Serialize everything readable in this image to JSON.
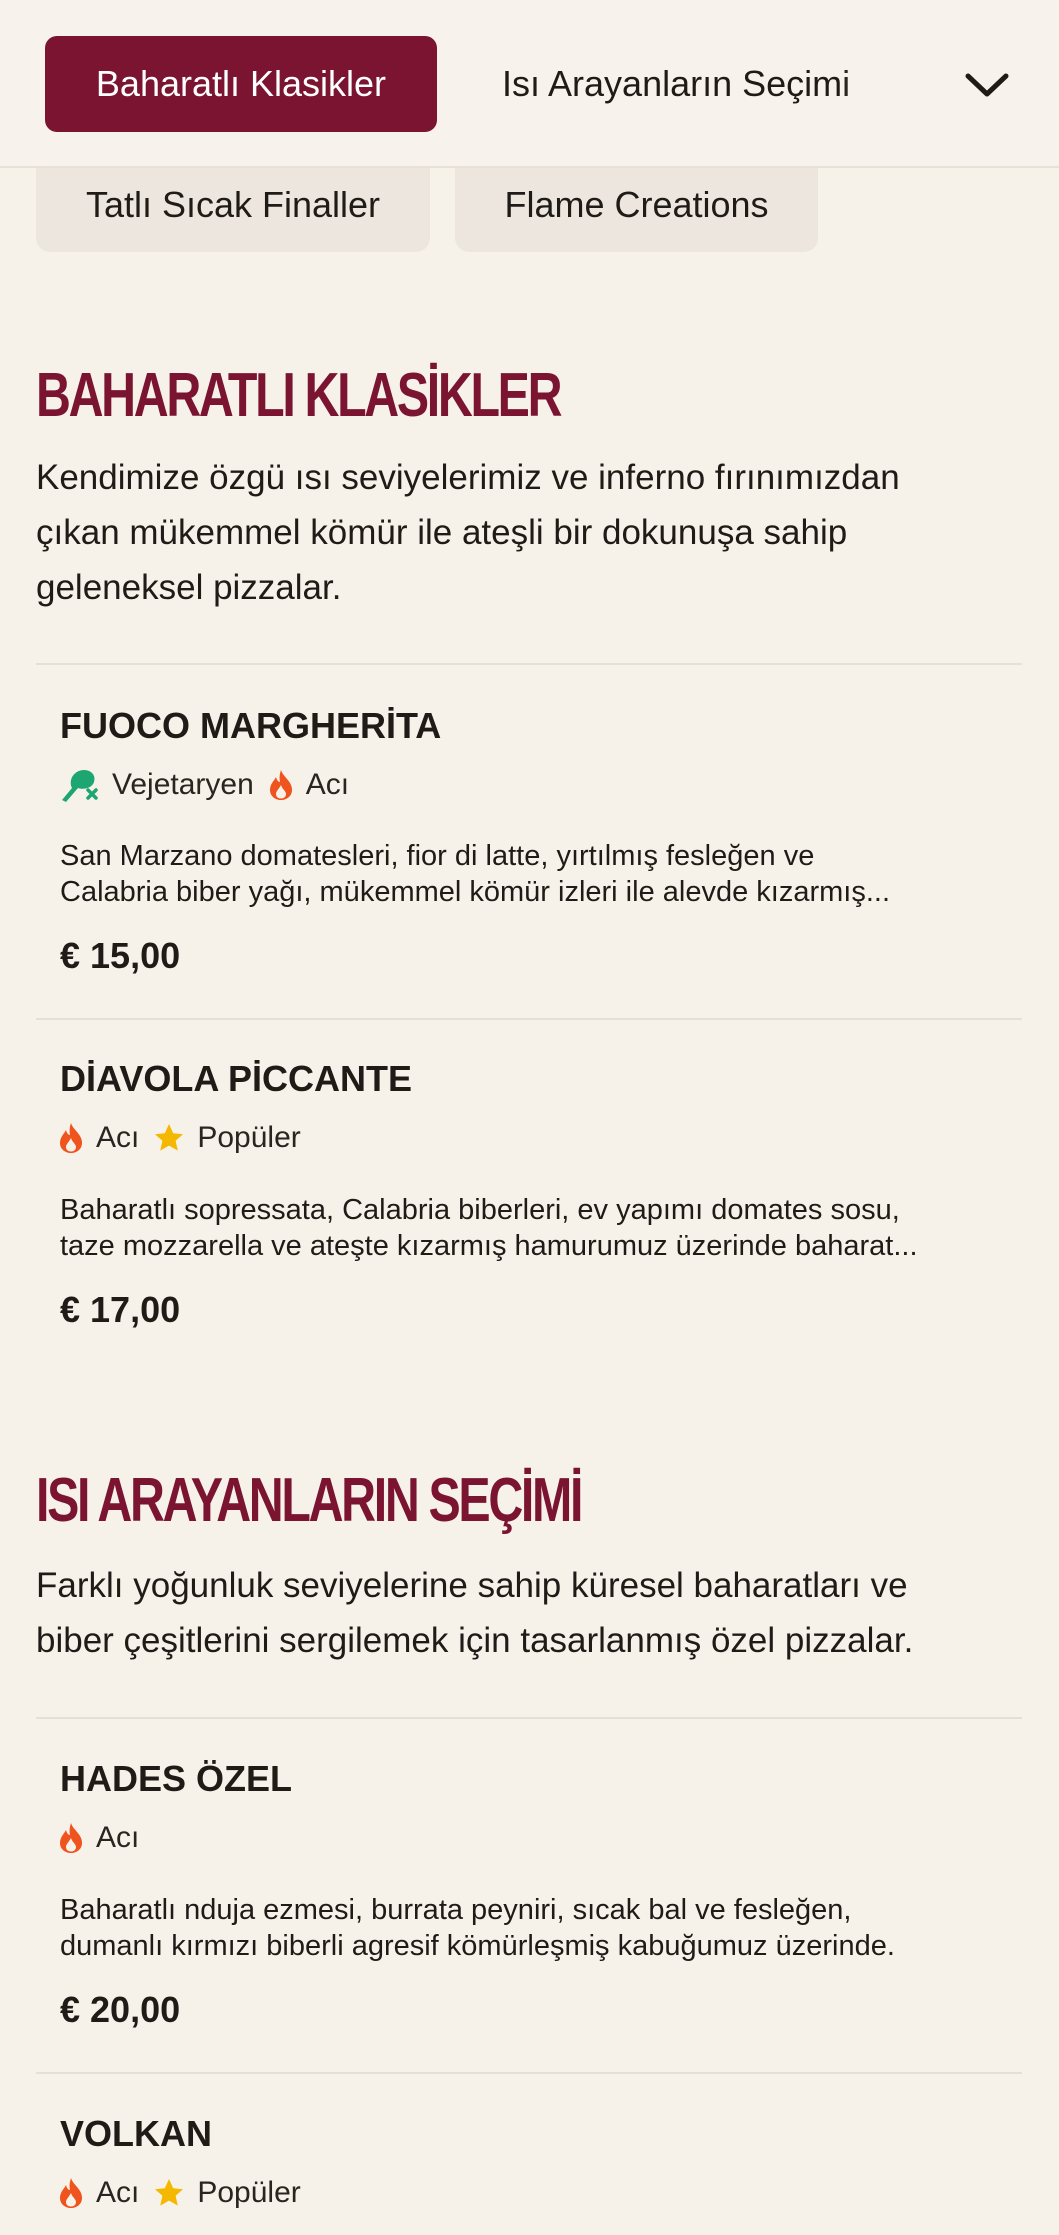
{
  "nav": {
    "active_label": "Baharatlı Klasikler",
    "second_label": "Isı Arayanların Seçimi",
    "row2": [
      "Tatlı Sıcak Finaller",
      "Flame Creations"
    ]
  },
  "sections": [
    {
      "title": "BAHARATLI KLASİKLER",
      "desc_lines": [
        "Kendimize özgü ısı seviyelerimiz ve inferno fırınımızdan",
        "çıkan mükemmel kömür ile ateşli bir dokunuşa sahip",
        "geleneksel pizzalar."
      ],
      "items": [
        {
          "name": "FUOCO MARGHERİTA",
          "tags": [
            {
              "icon": "vegetarian-icon",
              "label": "Vejetaryen"
            },
            {
              "icon": "flame-icon",
              "label": "Acı"
            }
          ],
          "desc_lines": [
            "San Marzano domatesleri, fior di latte, yırtılmış fesleğen ve",
            "Calabria biber yağı, mükemmel kömür izleri ile alevde kızarmış..."
          ],
          "price": "€ 15,00"
        },
        {
          "name": "DİAVOLA PİCCANTE",
          "tags": [
            {
              "icon": "flame-icon",
              "label": "Acı"
            },
            {
              "icon": "star-icon",
              "label": "Popüler"
            }
          ],
          "desc_lines": [
            "Baharatlı sopressata, Calabria biberleri, ev yapımı domates sosu,",
            "taze mozzarella ve ateşte kızarmış hamurumuz üzerinde baharat..."
          ],
          "price": "€ 17,00"
        }
      ]
    },
    {
      "title": "ISI ARAYANLARIN SEÇİMİ",
      "desc_lines": [
        "Farklı yoğunluk seviyelerine sahip küresel baharatları ve",
        "biber çeşitlerini sergilemek için tasarlanmış özel pizzalar."
      ],
      "items": [
        {
          "name": "HADES ÖZEL",
          "tags": [
            {
              "icon": "flame-icon",
              "label": "Acı"
            }
          ],
          "desc_lines": [
            "Baharatlı nduja ezmesi, burrata peyniri, sıcak bal ve fesleğen,",
            "dumanlı kırmızı biberli agresif kömürleşmiş kabuğumuz üzerinde."
          ],
          "price": "€ 20,00"
        },
        {
          "name": "VOLKAN",
          "tags": [
            {
              "icon": "flame-icon",
              "label": "Acı"
            },
            {
              "icon": "star-icon",
              "label": "Popüler"
            }
          ]
        }
      ]
    }
  ],
  "colors": {
    "accent": "#7a1431",
    "background": "#f6f2ea",
    "flame": "#f0541e",
    "star": "#f5b800",
    "vegetarian": "#1ea672"
  }
}
